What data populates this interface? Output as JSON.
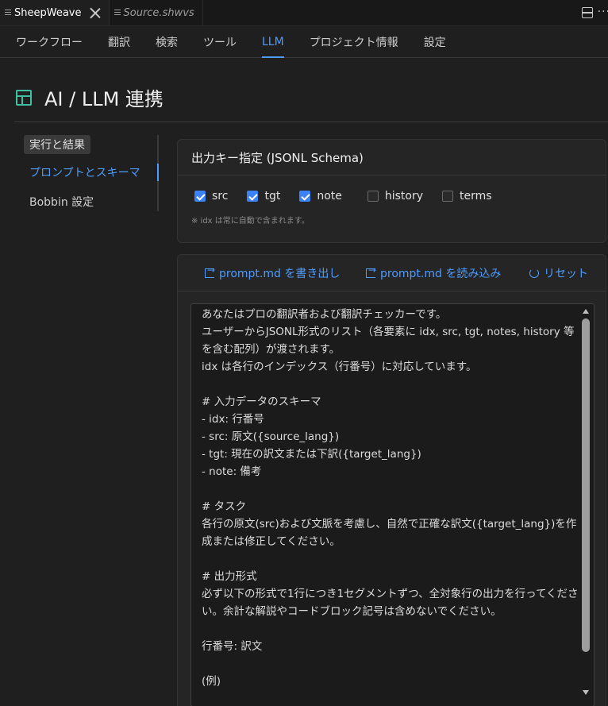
{
  "editor_tabs": [
    {
      "label": "SheepWeave",
      "active": true
    },
    {
      "label": "Source.shwvs",
      "active": false
    }
  ],
  "nav": {
    "items": [
      "ワークフロー",
      "翻訳",
      "検索",
      "ツール",
      "LLM",
      "プロジェクト情報",
      "設定"
    ],
    "active": "LLM"
  },
  "page": {
    "title": "AI / LLM 連携",
    "icon": "layout-icon"
  },
  "sidenav": {
    "items": [
      "実行と結果",
      "プロンプトとスキーマ",
      "Bobbin 設定"
    ],
    "active": "プロンプトとスキーマ"
  },
  "schema_card": {
    "title": "出力キー指定 (JSONL Schema)",
    "keys": [
      {
        "label": "src",
        "checked": true
      },
      {
        "label": "tgt",
        "checked": true
      },
      {
        "label": "note",
        "checked": true
      },
      {
        "label": "history",
        "checked": false
      },
      {
        "label": "terms",
        "checked": false
      }
    ],
    "note": "※ idx は常に自動で含まれます。"
  },
  "prompt_card": {
    "export_label": "prompt.md を書き出し",
    "import_label": "prompt.md を読み込み",
    "reset_label": "リセット",
    "prompt_text": "あなたはプロの翻訳者および翻訳チェッカーです。\nユーザーからJSONL形式のリスト（各要素に idx, src, tgt, notes, history 等を含む配列）が渡されます。\nidx は各行のインデックス（行番号）に対応しています。\n\n# 入力データのスキーマ\n- idx: 行番号\n- src: 原文({source_lang})\n- tgt: 現在の訳文または下訳({target_lang})\n- note: 備考\n\n# タスク\n各行の原文(src)および文脈を考慮し、自然で正確な訳文({target_lang})を作成または修正してください。\n\n# 出力形式\n必ず以下の形式で1行につき1セグメントずつ、全対象行の出力を行ってください。余計な解説やコードブロック記号は含めないでください。\n\n行番号: 訳文\n\n(例)"
  },
  "colors": {
    "accent": "#4d9cff",
    "checkbox": "#3b82f6",
    "icon_green": "#3fbf9f"
  }
}
